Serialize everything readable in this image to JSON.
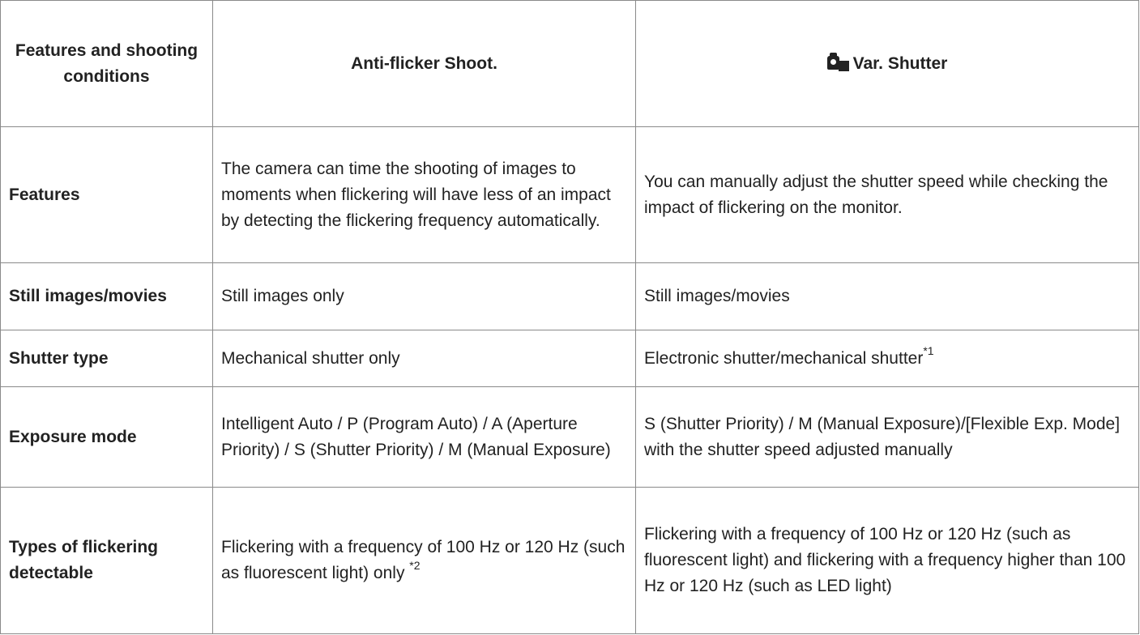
{
  "header": {
    "col1": "Features and shooting conditions",
    "col2": "Anti-flicker Shoot.",
    "col3": "Var. Shutter",
    "col3_icon": "camera-variable-shutter-icon"
  },
  "rows": [
    {
      "label": "Features",
      "anti_flicker": "The camera can time the shooting of images to moments when flickering will have less of an impact by detecting the flickering frequency automatically.",
      "var_shutter": "You can manually adjust the shutter speed while checking the impact of flickering on the monitor."
    },
    {
      "label": "Still images/movies",
      "anti_flicker": "Still images only",
      "var_shutter": "Still images/movies"
    },
    {
      "label": "Shutter type",
      "anti_flicker": "Mechanical shutter only",
      "var_shutter": "Electronic shutter/mechanical shutter",
      "var_shutter_note": "*1"
    },
    {
      "label": "Exposure mode",
      "anti_flicker": "Intelligent Auto / P (Program Auto) / A (Aperture Priority) / S (Shutter Priority) / M (Manual Exposure)",
      "var_shutter": "S (Shutter Priority) / M (Manual Exposure)/[Flexible Exp. Mode] with the shutter speed adjusted manually"
    },
    {
      "label": "Types of flickering detectable",
      "anti_flicker": "Flickering with a frequency of 100 Hz or 120 Hz (such as fluorescent light) only ",
      "anti_flicker_note": "*2",
      "var_shutter": "Flickering with a frequency of 100 Hz or 120 Hz (such as fluorescent light) and flickering with a frequency higher than 100 Hz or 120 Hz (such as LED light)"
    }
  ]
}
